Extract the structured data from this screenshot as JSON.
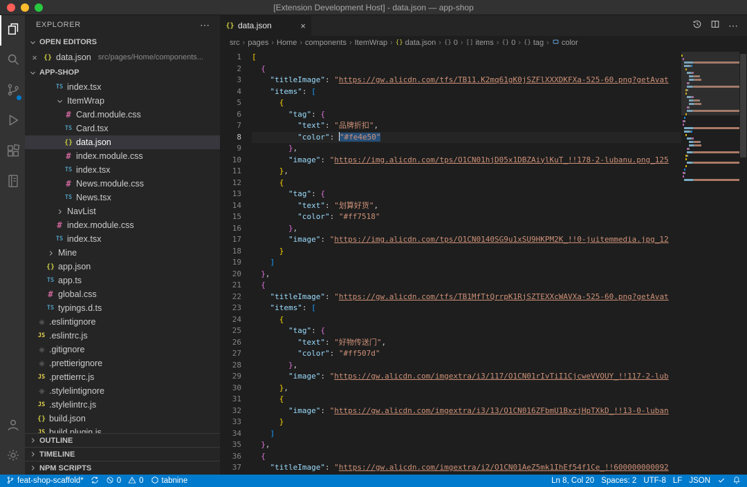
{
  "colors": {
    "accent": "#007acc",
    "titlebar": "#323233",
    "activitybar": "#333333",
    "sidebar": "#252526",
    "editor": "#1e1e1e",
    "selection": "#264f78",
    "list-selection": "#37373d",
    "json-key": "#9cdcfe",
    "json-string": "#ce9178",
    "bracket-1": "#ffd700",
    "bracket-2": "#da70d6",
    "bracket-3": "#179fff",
    "traffic-close": "#ff5f57",
    "traffic-min": "#febc2e",
    "traffic-max": "#28c840"
  },
  "window": {
    "title": "[Extension Development Host] - data.json — app-shop"
  },
  "activity_bar": {
    "items": [
      {
        "name": "explorer",
        "icon": "files",
        "active": true
      },
      {
        "name": "search",
        "icon": "search"
      },
      {
        "name": "source-control",
        "icon": "scm",
        "badge": true
      },
      {
        "name": "run-and-debug",
        "icon": "debug"
      },
      {
        "name": "extensions",
        "icon": "ext"
      },
      {
        "name": "notebook",
        "icon": "notebook"
      }
    ],
    "bottom": [
      {
        "name": "accounts",
        "icon": "account"
      },
      {
        "name": "manage",
        "icon": "gear"
      }
    ]
  },
  "sidebar": {
    "header": "EXPLORER",
    "more_icon": "⋯",
    "open_editors": {
      "label": "OPEN EDITORS",
      "items": [
        {
          "file": "data.json",
          "path": "src/pages/Home/components...",
          "icon": "json",
          "close": "×"
        }
      ]
    },
    "workspace_label": "APP-SHOP",
    "tree": [
      {
        "name": "index.tsx",
        "icon": "ts",
        "indent": 2
      },
      {
        "name": "ItemWrap",
        "type": "folder",
        "expanded": true,
        "indent": 2
      },
      {
        "name": "Card.module.css",
        "icon": "css",
        "indent": 3
      },
      {
        "name": "Card.tsx",
        "icon": "ts",
        "indent": 3
      },
      {
        "name": "data.json",
        "icon": "json",
        "indent": 3,
        "selected": true
      },
      {
        "name": "index.module.css",
        "icon": "css",
        "indent": 3
      },
      {
        "name": "index.tsx",
        "icon": "ts",
        "indent": 3
      },
      {
        "name": "News.module.css",
        "icon": "css",
        "indent": 3
      },
      {
        "name": "News.tsx",
        "icon": "ts",
        "indent": 3
      },
      {
        "name": "NavList",
        "type": "folder",
        "indent": 2
      },
      {
        "name": "index.module.css",
        "icon": "css",
        "indent": 2
      },
      {
        "name": "index.tsx",
        "icon": "ts",
        "indent": 2
      },
      {
        "name": "Mine",
        "type": "folder",
        "indent": 1
      },
      {
        "name": "app.json",
        "icon": "json",
        "indent": 1
      },
      {
        "name": "app.ts",
        "icon": "ts",
        "indent": 1
      },
      {
        "name": "global.css",
        "icon": "css",
        "indent": 1
      },
      {
        "name": "typings.d.ts",
        "icon": "ts",
        "indent": 1
      },
      {
        "name": ".eslintignore",
        "icon": "gear",
        "indent": 0
      },
      {
        "name": ".eslintrc.js",
        "icon": "js",
        "indent": 0
      },
      {
        "name": ".gitignore",
        "icon": "gear",
        "indent": 0
      },
      {
        "name": ".prettierignore",
        "icon": "gear",
        "indent": 0
      },
      {
        "name": ".prettierrc.js",
        "icon": "js",
        "indent": 0
      },
      {
        "name": ".stylelintignore",
        "icon": "gear",
        "indent": 0
      },
      {
        "name": ".stylelintrc.js",
        "icon": "js",
        "indent": 0
      },
      {
        "name": "build.json",
        "icon": "json",
        "indent": 0
      },
      {
        "name": "build.plugin.js",
        "icon": "js",
        "indent": 0
      }
    ],
    "bottom_sections": [
      "OUTLINE",
      "TIMELINE",
      "NPM SCRIPTS"
    ]
  },
  "editor": {
    "tabs": [
      {
        "label": "data.json",
        "icon": "json",
        "active": true,
        "close": "×"
      }
    ],
    "actions": [
      {
        "name": "history"
      },
      {
        "name": "split-editor"
      },
      {
        "name": "more-actions"
      }
    ],
    "breadcrumbs": [
      {
        "label": "src"
      },
      {
        "label": "pages"
      },
      {
        "label": "Home"
      },
      {
        "label": "components"
      },
      {
        "label": "ItemWrap"
      },
      {
        "label": "data.json",
        "icon": "json"
      },
      {
        "label": "0",
        "icon": "obj"
      },
      {
        "label": "items",
        "icon": "arr"
      },
      {
        "label": "0",
        "icon": "obj"
      },
      {
        "label": "tag",
        "icon": "obj"
      },
      {
        "label": "color",
        "icon": "field"
      }
    ],
    "active_line": 8,
    "lines": [
      {
        "n": 1,
        "t": [
          [
            "[",
            "b1"
          ]
        ]
      },
      {
        "n": 2,
        "t": [
          [
            "  ",
            ""
          ],
          [
            "{",
            "b2"
          ]
        ]
      },
      {
        "n": 3,
        "t": [
          [
            "    ",
            ""
          ],
          [
            "\"titleImage\"",
            "key"
          ],
          [
            ": ",
            "pun"
          ],
          [
            "\"",
            "str"
          ],
          [
            "https://gw.alicdn.com/tfs/TB11.K2mq61gK0jSZFlXXXDKFXa-525-60.png?getAvat",
            "url"
          ]
        ]
      },
      {
        "n": 4,
        "t": [
          [
            "    ",
            ""
          ],
          [
            "\"items\"",
            "key"
          ],
          [
            ": ",
            "pun"
          ],
          [
            "[",
            "b3"
          ]
        ]
      },
      {
        "n": 5,
        "t": [
          [
            "      ",
            ""
          ],
          [
            "{",
            "b1"
          ]
        ]
      },
      {
        "n": 6,
        "t": [
          [
            "        ",
            ""
          ],
          [
            "\"tag\"",
            "key"
          ],
          [
            ": ",
            "pun"
          ],
          [
            "{",
            "b2"
          ]
        ]
      },
      {
        "n": 7,
        "t": [
          [
            "          ",
            ""
          ],
          [
            "\"text\"",
            "key"
          ],
          [
            ": ",
            "pun"
          ],
          [
            "\"品牌折扣\"",
            "str"
          ],
          [
            ",",
            "pun"
          ]
        ]
      },
      {
        "n": 8,
        "t": [
          [
            "          ",
            ""
          ],
          [
            "\"color\"",
            "key"
          ],
          [
            ": ",
            "pun"
          ],
          [
            "\"#fe4e50\"",
            "str sel"
          ]
        ]
      },
      {
        "n": 9,
        "t": [
          [
            "        ",
            ""
          ],
          [
            "}",
            "b2"
          ],
          [
            ",",
            "pun"
          ]
        ]
      },
      {
        "n": 10,
        "t": [
          [
            "        ",
            ""
          ],
          [
            "\"image\"",
            "key"
          ],
          [
            ": ",
            "pun"
          ],
          [
            "\"",
            "str"
          ],
          [
            "https://img.alicdn.com/tps/O1CN01hjD05x1DBZAiylKuT_!!178-2-lubanu.png_125",
            "url"
          ]
        ]
      },
      {
        "n": 11,
        "t": [
          [
            "      ",
            ""
          ],
          [
            "}",
            "b1"
          ],
          [
            ",",
            "pun"
          ]
        ]
      },
      {
        "n": 12,
        "t": [
          [
            "      ",
            ""
          ],
          [
            "{",
            "b1"
          ]
        ]
      },
      {
        "n": 13,
        "t": [
          [
            "        ",
            ""
          ],
          [
            "\"tag\"",
            "key"
          ],
          [
            ": ",
            "pun"
          ],
          [
            "{",
            "b2"
          ]
        ]
      },
      {
        "n": 14,
        "t": [
          [
            "          ",
            ""
          ],
          [
            "\"text\"",
            "key"
          ],
          [
            ": ",
            "pun"
          ],
          [
            "\"划算好货\"",
            "str"
          ],
          [
            ",",
            "pun"
          ]
        ]
      },
      {
        "n": 15,
        "t": [
          [
            "          ",
            ""
          ],
          [
            "\"color\"",
            "key"
          ],
          [
            ": ",
            "pun"
          ],
          [
            "\"#ff7518\"",
            "str"
          ]
        ]
      },
      {
        "n": 16,
        "t": [
          [
            "        ",
            ""
          ],
          [
            "}",
            "b2"
          ],
          [
            ",",
            "pun"
          ]
        ]
      },
      {
        "n": 17,
        "t": [
          [
            "        ",
            ""
          ],
          [
            "\"image\"",
            "key"
          ],
          [
            ": ",
            "pun"
          ],
          [
            "\"",
            "str"
          ],
          [
            "https://img.alicdn.com/tps/O1CN0140SG9u1xSU9HKPM2K_!!0-juitemmedia.jpg_12",
            "url"
          ]
        ]
      },
      {
        "n": 18,
        "t": [
          [
            "      ",
            ""
          ],
          [
            "}",
            "b1"
          ]
        ]
      },
      {
        "n": 19,
        "t": [
          [
            "    ",
            ""
          ],
          [
            "]",
            "b3"
          ]
        ]
      },
      {
        "n": 20,
        "t": [
          [
            "  ",
            ""
          ],
          [
            "}",
            "b2"
          ],
          [
            ",",
            "pun"
          ]
        ]
      },
      {
        "n": 21,
        "t": [
          [
            "  ",
            ""
          ],
          [
            "{",
            "b2"
          ]
        ]
      },
      {
        "n": 22,
        "t": [
          [
            "    ",
            ""
          ],
          [
            "\"titleImage\"",
            "key"
          ],
          [
            ": ",
            "pun"
          ],
          [
            "\"",
            "str"
          ],
          [
            "https://gw.alicdn.com/tfs/TB1MfTtQrrpK1RjSZTEXXcWAVXa-525-60.png?getAvat",
            "url"
          ]
        ]
      },
      {
        "n": 23,
        "t": [
          [
            "    ",
            ""
          ],
          [
            "\"items\"",
            "key"
          ],
          [
            ": ",
            "pun"
          ],
          [
            "[",
            "b3"
          ]
        ]
      },
      {
        "n": 24,
        "t": [
          [
            "      ",
            ""
          ],
          [
            "{",
            "b1"
          ]
        ]
      },
      {
        "n": 25,
        "t": [
          [
            "        ",
            ""
          ],
          [
            "\"tag\"",
            "key"
          ],
          [
            ": ",
            "pun"
          ],
          [
            "{",
            "b2"
          ]
        ]
      },
      {
        "n": 26,
        "t": [
          [
            "          ",
            ""
          ],
          [
            "\"text\"",
            "key"
          ],
          [
            ": ",
            "pun"
          ],
          [
            "\"好物传送门\"",
            "str"
          ],
          [
            ",",
            "pun"
          ]
        ]
      },
      {
        "n": 27,
        "t": [
          [
            "          ",
            ""
          ],
          [
            "\"color\"",
            "key"
          ],
          [
            ": ",
            "pun"
          ],
          [
            "\"#ff507d\"",
            "str"
          ]
        ]
      },
      {
        "n": 28,
        "t": [
          [
            "        ",
            ""
          ],
          [
            "}",
            "b2"
          ],
          [
            ",",
            "pun"
          ]
        ]
      },
      {
        "n": 29,
        "t": [
          [
            "        ",
            ""
          ],
          [
            "\"image\"",
            "key"
          ],
          [
            ": ",
            "pun"
          ],
          [
            "\"",
            "str"
          ],
          [
            "https://gw.alicdn.com/imgextra/i3/117/O1CN01rIvTiI1CjcweVVOUY_!!117-2-lub",
            "url"
          ]
        ]
      },
      {
        "n": 30,
        "t": [
          [
            "      ",
            ""
          ],
          [
            "}",
            "b1"
          ],
          [
            ",",
            "pun"
          ]
        ]
      },
      {
        "n": 31,
        "t": [
          [
            "      ",
            ""
          ],
          [
            "{",
            "b1"
          ]
        ]
      },
      {
        "n": 32,
        "t": [
          [
            "        ",
            ""
          ],
          [
            "\"image\"",
            "key"
          ],
          [
            ": ",
            "pun"
          ],
          [
            "\"",
            "str"
          ],
          [
            "https://gw.alicdn.com/imgextra/i3/13/O1CN016ZFbmU1BxzjHpTXkD_!!13-0-luban",
            "url"
          ]
        ]
      },
      {
        "n": 33,
        "t": [
          [
            "      ",
            ""
          ],
          [
            "}",
            "b1"
          ]
        ]
      },
      {
        "n": 34,
        "t": [
          [
            "    ",
            ""
          ],
          [
            "]",
            "b3"
          ]
        ]
      },
      {
        "n": 35,
        "t": [
          [
            "  ",
            ""
          ],
          [
            "}",
            "b2"
          ],
          [
            ",",
            "pun"
          ]
        ]
      },
      {
        "n": 36,
        "t": [
          [
            "  ",
            ""
          ],
          [
            "{",
            "b2"
          ]
        ]
      },
      {
        "n": 37,
        "t": [
          [
            "    ",
            ""
          ],
          [
            "\"titleImage\"",
            "key"
          ],
          [
            ": ",
            "pun"
          ],
          [
            "\"",
            "str"
          ],
          [
            "https://gw.alicdn.com/imgextra/i2/O1CN01AeZ5mk1IhEf54f1Ce_!!600000000092",
            "url"
          ]
        ]
      }
    ]
  },
  "status_bar": {
    "left": [
      {
        "name": "git-branch",
        "icon": "branch",
        "label": "feat-shop-scaffold*"
      },
      {
        "name": "sync-changes",
        "icon": "sync",
        "label": ""
      },
      {
        "name": "problems-errors",
        "icon": "error",
        "label": "0"
      },
      {
        "name": "problems-warnings",
        "icon": "warning",
        "label": "0"
      },
      {
        "name": "tabnine",
        "icon": "tabnine",
        "label": "tabnine"
      }
    ],
    "right": [
      {
        "name": "cursor-position",
        "label": "Ln 8, Col 20"
      },
      {
        "name": "indentation",
        "label": "Spaces: 2"
      },
      {
        "name": "encoding",
        "label": "UTF-8"
      },
      {
        "name": "eol",
        "label": "LF"
      },
      {
        "name": "language-mode",
        "label": "JSON"
      },
      {
        "name": "formatter",
        "icon": "check",
        "label": ""
      },
      {
        "name": "notifications",
        "icon": "bell",
        "label": ""
      }
    ]
  }
}
